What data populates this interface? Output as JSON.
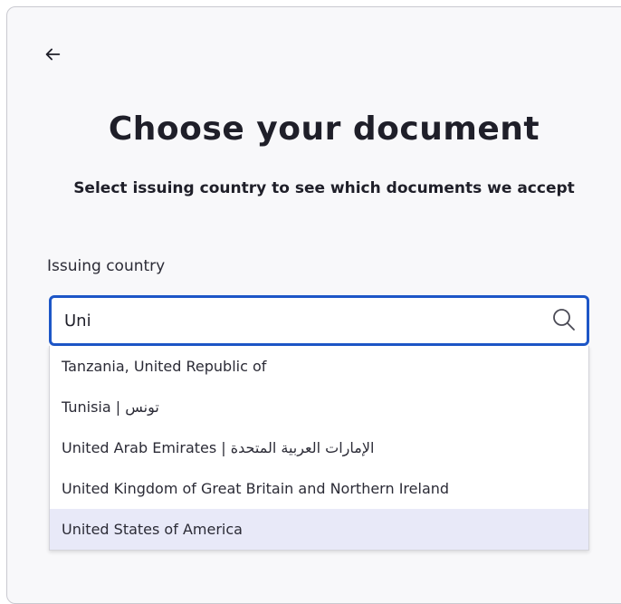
{
  "header": {
    "back_icon": "arrow-left-icon",
    "title": "Choose your document",
    "subtitle": "Select issuing country to see which documents we accept"
  },
  "country_field": {
    "label": "Issuing country",
    "value": "Uni",
    "search_icon": "search-icon",
    "focus_color": "#1d56c7"
  },
  "dropdown": {
    "options": [
      "Tanzania, United Republic of",
      "Tunisia | تونس",
      "United Arab Emirates | الإمارات العربية المتحدة",
      "United Kingdom of Great Britain and Northern Ireland",
      "United States of America"
    ],
    "highlighted_index": 4,
    "highlight_color": "#e8e9f8"
  }
}
